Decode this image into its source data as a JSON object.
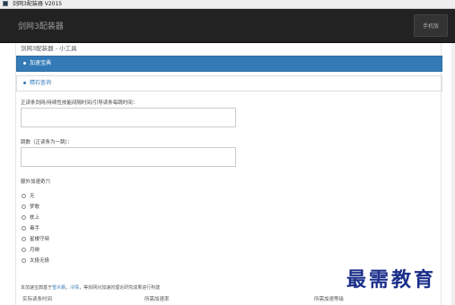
{
  "window": {
    "title": "剑网3配装器 V2015"
  },
  "navbar": {
    "brand": "剑网3配装器",
    "button_label": "手机版"
  },
  "page": {
    "header": "剑网3配装器 - 小工具"
  },
  "list": [
    {
      "label": "加速宝典",
      "active": true
    },
    {
      "label": "精石查询",
      "active": false
    }
  ],
  "form": {
    "field1_label": "正读条剑网/持续性技能间隔时间/引导读条每跳时间：",
    "field1_value": "",
    "field2_label": "跳数（正读条为一跳）：",
    "field2_value": "",
    "radio_group_label": "额外加速奇穴",
    "radio_options": [
      "无",
      "梦歌",
      "枕上",
      "毒手",
      "星楼守時",
      "月映",
      "太极无极"
    ]
  },
  "footnote": {
    "text_before": "本加速宝典基于",
    "link1": "雪炎枫",
    "link_sep": "，",
    "link2": "冷情",
    "text_after": "，等剑网对加速的理论研究成果进行构建"
  },
  "table": {
    "headers": [
      "实际读条时间",
      "所需加速率",
      "所需加速等级"
    ]
  },
  "watermark": {
    "text": "最需教育"
  },
  "colors": {
    "navbar": "#222222",
    "active": "#337ab7",
    "watermark": "#1b2f8a"
  }
}
